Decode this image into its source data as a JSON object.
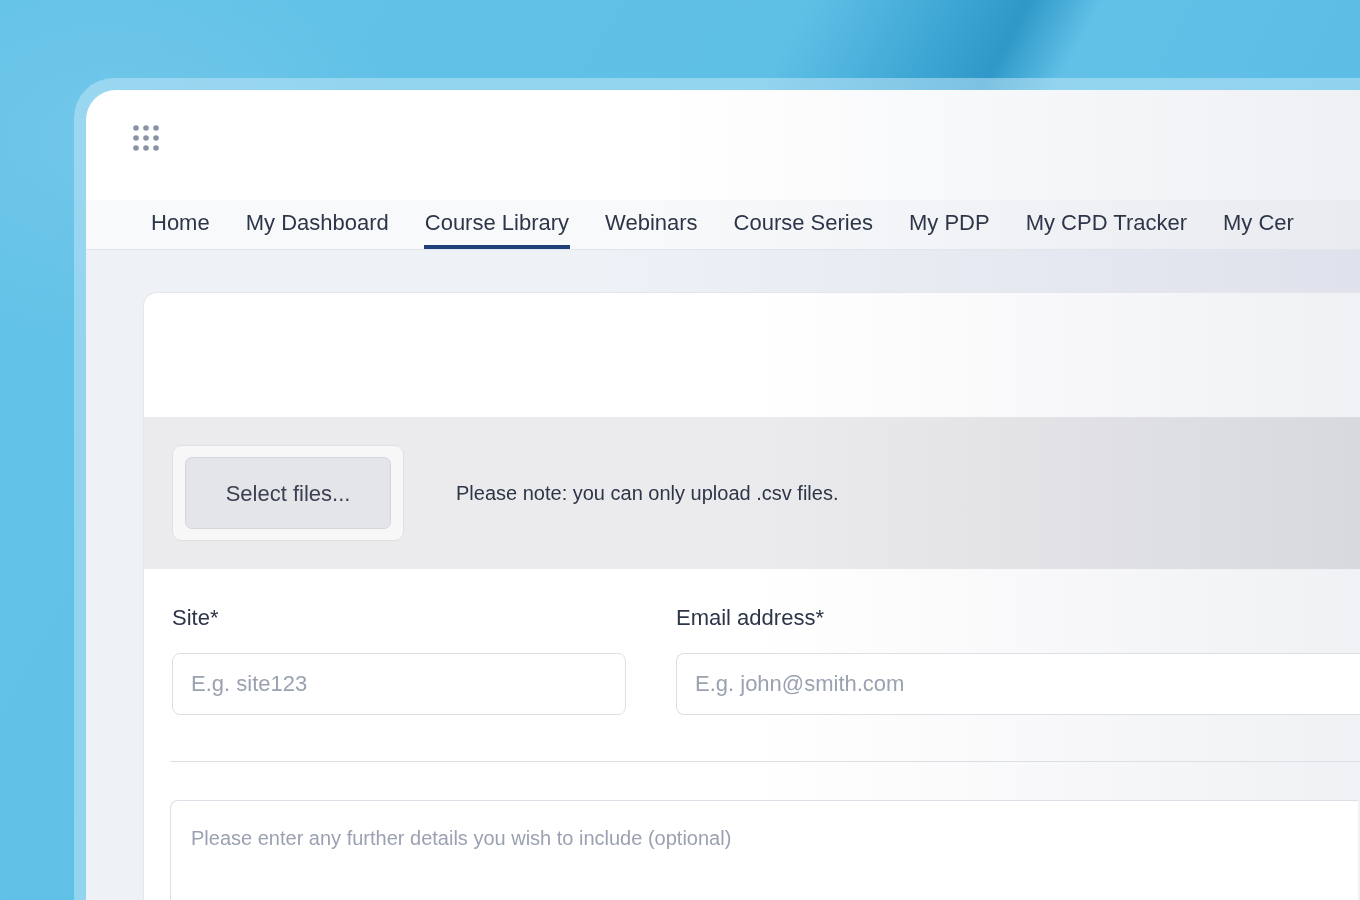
{
  "nav": {
    "tabs": [
      {
        "label": "Home",
        "selected": false
      },
      {
        "label": "My Dashboard",
        "selected": false
      },
      {
        "label": "Course Library",
        "selected": true
      },
      {
        "label": "Webinars",
        "selected": false
      },
      {
        "label": "Course Series",
        "selected": false
      },
      {
        "label": "My PDP",
        "selected": false
      },
      {
        "label": "My CPD Tracker",
        "selected": false
      },
      {
        "label": "My Cer",
        "selected": false
      }
    ]
  },
  "upload": {
    "button": "Select files...",
    "note": "Please note: you can only upload .csv files."
  },
  "form": {
    "fields": [
      {
        "label": "Site*",
        "placeholder": "E.g. site123"
      },
      {
        "label": "Email address*",
        "placeholder": "E.g. john@smith.com"
      }
    ],
    "details": {
      "placeholder": "Please enter any further details you wish to include (optional)"
    }
  }
}
